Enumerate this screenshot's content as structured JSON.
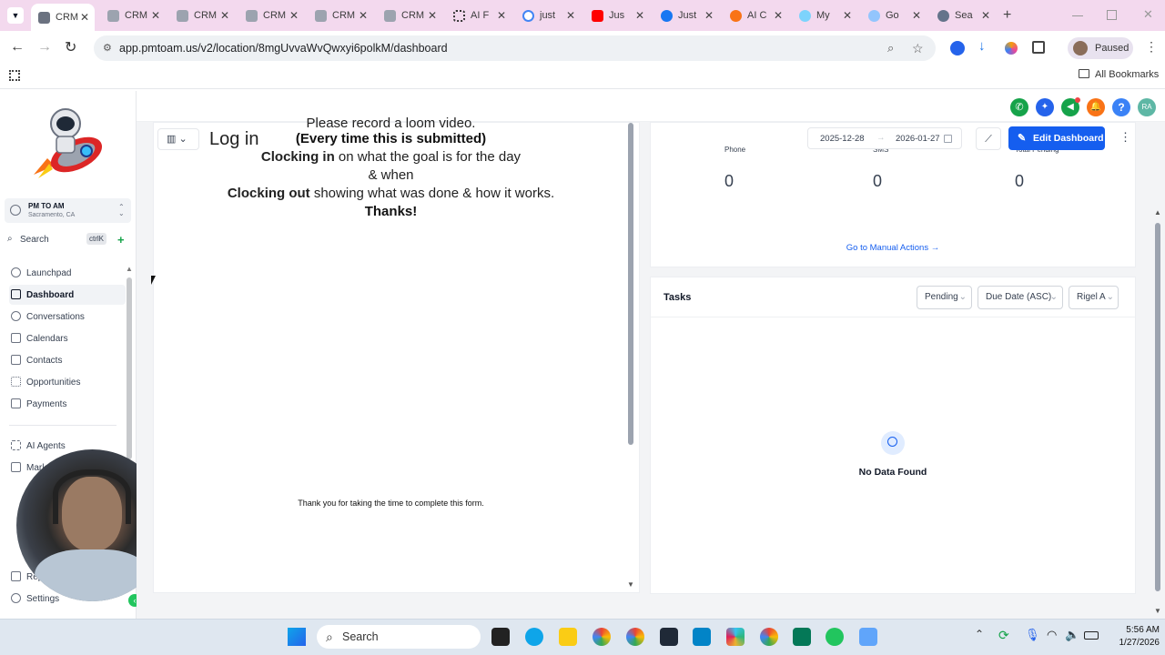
{
  "browser": {
    "tabs": [
      {
        "label": "CRM",
        "active": true,
        "color": "#6b7280"
      },
      {
        "label": "CRM",
        "color": "#6b7280"
      },
      {
        "label": "CRM",
        "color": "#6b7280"
      },
      {
        "label": "CRM",
        "color": "#6b7280"
      },
      {
        "label": "CRM",
        "color": "#6b7280"
      },
      {
        "label": "CRM",
        "color": "#6b7280"
      },
      {
        "label": "AI F",
        "color": "#444"
      },
      {
        "label": "just",
        "color": "#4285f4"
      },
      {
        "label": "Jus",
        "color": "#ff0000"
      },
      {
        "label": "Just",
        "color": "#1877f2"
      },
      {
        "label": "AI C",
        "color": "#f97316"
      },
      {
        "label": "My",
        "color": "#0ea5e9"
      },
      {
        "label": "Go",
        "color": "#60a5fa"
      },
      {
        "label": "Sea",
        "color": "#64748b"
      }
    ],
    "url": "app.pmtoam.us/v2/location/8mgUvvaWvQwxyi6polkM/dashboard",
    "profile_status": "Paused",
    "bookmarks_label": "All Bookmarks"
  },
  "sidebar": {
    "account_name": "PM TO AM",
    "account_location": "Sacramento, CA",
    "search_placeholder": "Search",
    "search_shortcut": "ctrlK",
    "items": [
      {
        "label": "Launchpad"
      },
      {
        "label": "Dashboard",
        "active": true
      },
      {
        "label": "Conversations"
      },
      {
        "label": "Calendars"
      },
      {
        "label": "Contacts"
      },
      {
        "label": "Opportunities"
      },
      {
        "label": "Payments"
      }
    ],
    "items2": [
      {
        "label": "AI Agents"
      },
      {
        "label": "Mark"
      },
      {
        "label": "Rep"
      },
      {
        "label": "Settings"
      }
    ]
  },
  "header": {
    "date_start": "2025-12-28",
    "date_end": "2026-01-27",
    "edit_dashboard_label": "Edit Dashboard",
    "avatar_initials": "RA"
  },
  "form": {
    "login_label": "Log in",
    "line0": "Please record a loom video.",
    "line1": "(Every time this is submitted)",
    "line2_bold": "Clocking in",
    "line2_rest": " on what the goal is for the day",
    "line3": "& when",
    "line4_bold": "Clocking out",
    "line4_rest": " showing what was done & how it works.",
    "line5": "Thanks!",
    "thankyou": "Thank you for taking the time to complete this form."
  },
  "stats": {
    "columns": [
      {
        "label": "Phone",
        "value": "0"
      },
      {
        "label": "SMS",
        "value": "0"
      },
      {
        "label": "Total Pending",
        "value": "0"
      }
    ],
    "manual_actions_link": "Go to Manual Actions →"
  },
  "tasks": {
    "title": "Tasks",
    "filter_status": "Pending",
    "filter_sort": "Due Date (ASC)",
    "filter_user": "Rigel A",
    "empty_label": "No Data Found"
  },
  "taskbar": {
    "search_label": "Search",
    "time": "5:56 AM",
    "date": "1/27/2026"
  },
  "colors": {
    "primary": "#155eef",
    "tab_bar": "#f3d9ee",
    "call_green": "#16a34a",
    "notif_orange": "#f97316",
    "help_blue": "#3b82f6",
    "avatar_teal": "#5eb7a5"
  }
}
